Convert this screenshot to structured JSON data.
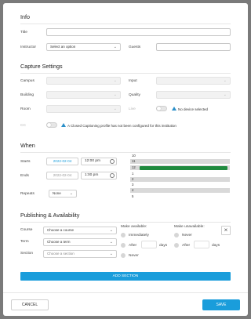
{
  "info": {
    "heading": "Info",
    "title_label": "Title",
    "instructor_label": "Instructor",
    "instructor_value": "Select an option",
    "guests_label": "Guests"
  },
  "capture": {
    "heading": "Capture Settings",
    "campus_label": "Campus",
    "input_label": "Input",
    "building_label": "Building",
    "quality_label": "Quality",
    "room_label": "Room",
    "live_label": "Live",
    "no_device": "No device selected",
    "cc_label": "CC",
    "cc_message": "A Closed Captioning profile has not been configured for this institution"
  },
  "when": {
    "heading": "When",
    "starts_label": "Starts",
    "start_date": "2022-02-04",
    "start_time": "12:00 pm",
    "ends_label": "Ends",
    "end_date": "2022-02-04",
    "end_time": "1:00 pm",
    "repeats_label": "Repeats",
    "repeats_value": "None",
    "schedule_hours": [
      "10",
      "11",
      "12",
      "1",
      "2",
      "3",
      "4",
      "5"
    ]
  },
  "publishing": {
    "heading": "Publishing & Availability",
    "course_label": "Course",
    "course_value": "Choose a course",
    "term_label": "Term",
    "term_value": "Choose a term",
    "section_label": "Section",
    "section_value": "Choose a section",
    "make_available": "Make available:",
    "immediately": "Immediately",
    "after": "After",
    "days": "days",
    "never": "Never",
    "make_unavailable": "Make unavailable:",
    "never2": "Never",
    "after2": "After",
    "days2": "days",
    "add_section": "ADD SECTION"
  },
  "footer": {
    "cancel": "CANCEL",
    "save": "SAVE"
  },
  "colors": {
    "accent": "#1a9ddb",
    "event_green": "#1f8a3e"
  }
}
